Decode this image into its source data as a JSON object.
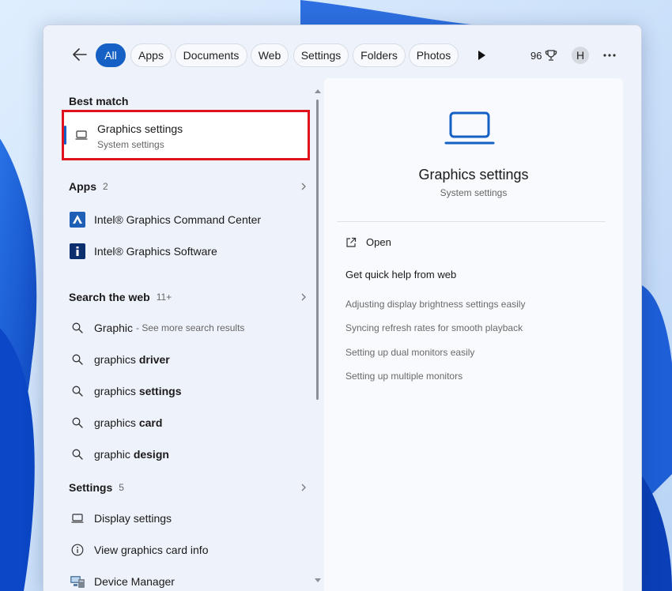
{
  "nav": {
    "tabs": [
      {
        "label": "All",
        "active": true
      },
      {
        "label": "Apps"
      },
      {
        "label": "Documents"
      },
      {
        "label": "Web"
      },
      {
        "label": "Settings"
      },
      {
        "label": "Folders"
      },
      {
        "label": "Photos"
      }
    ],
    "points": "96",
    "avatar_initial": "H"
  },
  "best_match": {
    "header": "Best match",
    "title": "Graphics settings",
    "subtitle": "System settings"
  },
  "apps": {
    "header": "Apps",
    "count": "2",
    "items": [
      {
        "label": "Intel® Graphics Command Center",
        "icon": "intel-command-center-icon"
      },
      {
        "label": "Intel® Graphics Software",
        "icon": "intel-info-icon"
      }
    ]
  },
  "web": {
    "header": "Search the web",
    "count": "11+",
    "items": [
      {
        "prefix": "Graphic",
        "bold": "",
        "hint": "- See more search results"
      },
      {
        "prefix": "graphics ",
        "bold": "driver",
        "hint": ""
      },
      {
        "prefix": "graphics ",
        "bold": "settings",
        "hint": ""
      },
      {
        "prefix": "graphics ",
        "bold": "card",
        "hint": ""
      },
      {
        "prefix": "graphic ",
        "bold": "design",
        "hint": ""
      }
    ]
  },
  "settings": {
    "header": "Settings",
    "count": "5",
    "items": [
      {
        "label": "Display settings",
        "icon": "laptop-icon"
      },
      {
        "label": "View graphics card info",
        "icon": "info-icon"
      },
      {
        "label": "Device Manager",
        "icon": "device-manager-icon"
      }
    ]
  },
  "preview": {
    "title": "Graphics settings",
    "subtitle": "System settings",
    "open_label": "Open",
    "help_header": "Get quick help from web",
    "links": [
      "Adjusting display brightness settings easily",
      "Syncing refresh rates for smooth playback",
      "Setting up dual monitors easily",
      "Setting up multiple monitors"
    ]
  },
  "colors": {
    "accent": "#1460c4",
    "highlight": "#e0121b"
  }
}
